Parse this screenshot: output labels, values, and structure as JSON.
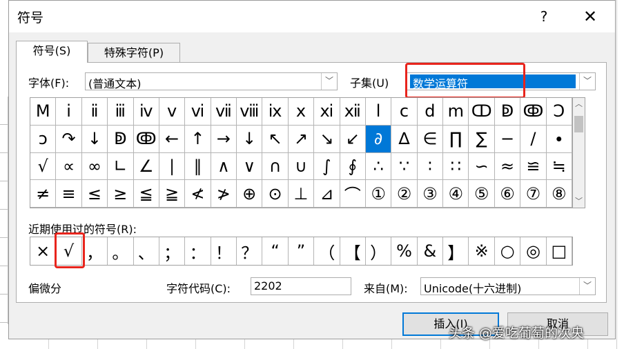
{
  "dialog": {
    "title": "符号",
    "help": "?",
    "close": "✕"
  },
  "tabs": [
    {
      "label": "符号(S)"
    },
    {
      "label": "特殊字符(P)"
    }
  ],
  "font": {
    "label": "字体(F):",
    "value": "(普通文本)"
  },
  "subset": {
    "label": "子集(U)",
    "value": "数学运算符"
  },
  "symbols": [
    "Ⅿ",
    "ⅰ",
    "ⅱ",
    "ⅲ",
    "ⅳ",
    "ⅴ",
    "ⅵ",
    "ⅶ",
    "ⅷ",
    "ⅸ",
    "ⅹ",
    "ⅺ",
    "ⅻ",
    "ⅼ",
    "ⅽ",
    "ⅾ",
    "ⅿ",
    "ↀ",
    "ↁ",
    "ↂ",
    "Ↄ",
    "ↄ",
    "↷",
    "↓",
    "ↁ",
    "ↂ",
    "←",
    "↑",
    "→",
    "↓",
    "↖",
    "↗",
    "↘",
    "↙",
    "∂",
    "∆",
    "∈",
    "∏",
    "∑",
    "−",
    "∕",
    "∙",
    "√",
    "∝",
    "∞",
    "∟",
    "∠",
    "∣",
    "∥",
    "∧",
    "∨",
    "∩",
    "∪",
    "∫",
    "∮",
    "∴",
    "∵",
    "∶",
    "∷",
    "∽",
    "≈",
    "≌",
    "≒",
    "≠",
    "≡",
    "≤",
    "≥",
    "≦",
    "≧",
    "≮",
    "≯",
    "⊕",
    "⊙",
    "⊥",
    "⊿",
    "⌒",
    "①",
    "②",
    "③",
    "④",
    "⑤",
    "⑥",
    "⑦",
    "⑧"
  ],
  "recent": {
    "label": "近期使用过的符号(R):",
    "symbols": [
      "×",
      "√",
      "，",
      "。",
      "、",
      "；",
      "：",
      "！",
      "？",
      "“",
      "”",
      "（",
      "【",
      "）",
      "%",
      "&",
      "】",
      "※",
      "○",
      "◎",
      "□"
    ]
  },
  "char_name": "偏微分",
  "char_code": {
    "label": "字符代码(C):",
    "value": "2202"
  },
  "from": {
    "label": "来自(M):",
    "value": "Unicode(十六进制)"
  },
  "buttons": {
    "insert": "插入(I)",
    "cancel": "取消"
  },
  "watermark": "头条 @爱吃葡萄的次央",
  "colors": {
    "selection": "#0078d7",
    "highlight_box": "#e8241c"
  }
}
